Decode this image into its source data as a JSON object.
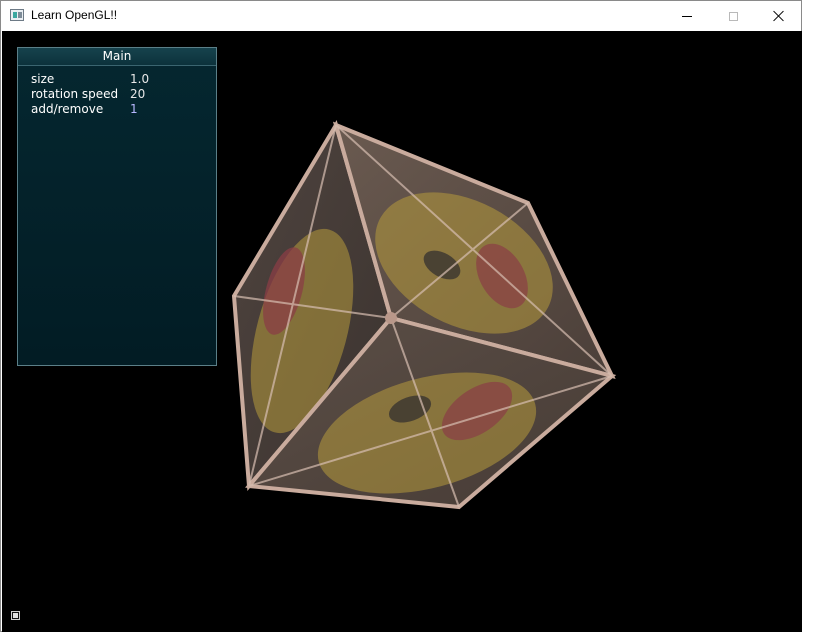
{
  "window": {
    "title": "Learn OpenGL!!",
    "icon": "opengl-app-icon",
    "controls": [
      "minimize-icon",
      "maximize-icon",
      "close-icon"
    ]
  },
  "panel": {
    "title": "Main",
    "rows": [
      {
        "label": "size",
        "value": "1.0"
      },
      {
        "label": "rotation speed",
        "value": "20"
      },
      {
        "label": "add/remove",
        "value": "1"
      }
    ]
  },
  "scene": {
    "background": "#000000",
    "object": "textured-crate-cube",
    "face_colors": {
      "wood": "#5a4d46",
      "emblem": "#b79a3c",
      "accent": "#8a3d46",
      "frame": "#c7a89a"
    }
  },
  "status": {
    "icon": "render-indicator-icon"
  }
}
